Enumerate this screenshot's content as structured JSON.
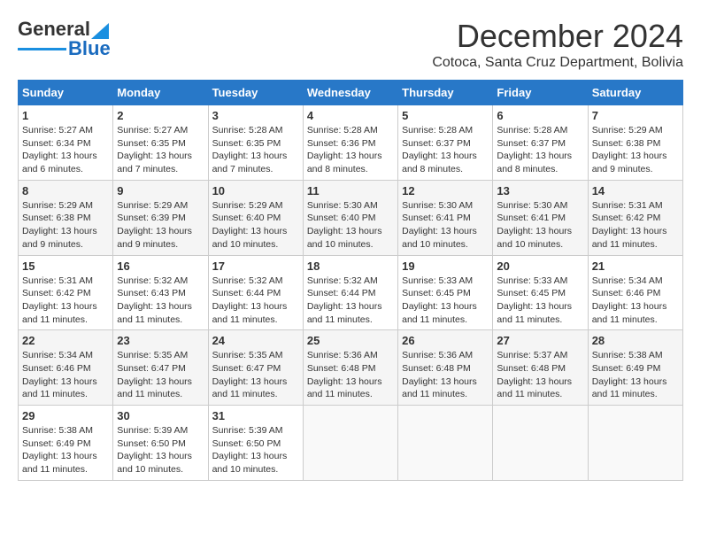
{
  "logo": {
    "line1": "General",
    "line2": "Blue"
  },
  "title": "December 2024",
  "subtitle": "Cotoca, Santa Cruz Department, Bolivia",
  "days_of_week": [
    "Sunday",
    "Monday",
    "Tuesday",
    "Wednesday",
    "Thursday",
    "Friday",
    "Saturday"
  ],
  "weeks": [
    [
      {
        "day": "1",
        "info": "Sunrise: 5:27 AM\nSunset: 6:34 PM\nDaylight: 13 hours and 6 minutes."
      },
      {
        "day": "2",
        "info": "Sunrise: 5:27 AM\nSunset: 6:35 PM\nDaylight: 13 hours and 7 minutes."
      },
      {
        "day": "3",
        "info": "Sunrise: 5:28 AM\nSunset: 6:35 PM\nDaylight: 13 hours and 7 minutes."
      },
      {
        "day": "4",
        "info": "Sunrise: 5:28 AM\nSunset: 6:36 PM\nDaylight: 13 hours and 8 minutes."
      },
      {
        "day": "5",
        "info": "Sunrise: 5:28 AM\nSunset: 6:37 PM\nDaylight: 13 hours and 8 minutes."
      },
      {
        "day": "6",
        "info": "Sunrise: 5:28 AM\nSunset: 6:37 PM\nDaylight: 13 hours and 8 minutes."
      },
      {
        "day": "7",
        "info": "Sunrise: 5:29 AM\nSunset: 6:38 PM\nDaylight: 13 hours and 9 minutes."
      }
    ],
    [
      {
        "day": "8",
        "info": "Sunrise: 5:29 AM\nSunset: 6:38 PM\nDaylight: 13 hours and 9 minutes."
      },
      {
        "day": "9",
        "info": "Sunrise: 5:29 AM\nSunset: 6:39 PM\nDaylight: 13 hours and 9 minutes."
      },
      {
        "day": "10",
        "info": "Sunrise: 5:29 AM\nSunset: 6:40 PM\nDaylight: 13 hours and 10 minutes."
      },
      {
        "day": "11",
        "info": "Sunrise: 5:30 AM\nSunset: 6:40 PM\nDaylight: 13 hours and 10 minutes."
      },
      {
        "day": "12",
        "info": "Sunrise: 5:30 AM\nSunset: 6:41 PM\nDaylight: 13 hours and 10 minutes."
      },
      {
        "day": "13",
        "info": "Sunrise: 5:30 AM\nSunset: 6:41 PM\nDaylight: 13 hours and 10 minutes."
      },
      {
        "day": "14",
        "info": "Sunrise: 5:31 AM\nSunset: 6:42 PM\nDaylight: 13 hours and 11 minutes."
      }
    ],
    [
      {
        "day": "15",
        "info": "Sunrise: 5:31 AM\nSunset: 6:42 PM\nDaylight: 13 hours and 11 minutes."
      },
      {
        "day": "16",
        "info": "Sunrise: 5:32 AM\nSunset: 6:43 PM\nDaylight: 13 hours and 11 minutes."
      },
      {
        "day": "17",
        "info": "Sunrise: 5:32 AM\nSunset: 6:44 PM\nDaylight: 13 hours and 11 minutes."
      },
      {
        "day": "18",
        "info": "Sunrise: 5:32 AM\nSunset: 6:44 PM\nDaylight: 13 hours and 11 minutes."
      },
      {
        "day": "19",
        "info": "Sunrise: 5:33 AM\nSunset: 6:45 PM\nDaylight: 13 hours and 11 minutes."
      },
      {
        "day": "20",
        "info": "Sunrise: 5:33 AM\nSunset: 6:45 PM\nDaylight: 13 hours and 11 minutes."
      },
      {
        "day": "21",
        "info": "Sunrise: 5:34 AM\nSunset: 6:46 PM\nDaylight: 13 hours and 11 minutes."
      }
    ],
    [
      {
        "day": "22",
        "info": "Sunrise: 5:34 AM\nSunset: 6:46 PM\nDaylight: 13 hours and 11 minutes."
      },
      {
        "day": "23",
        "info": "Sunrise: 5:35 AM\nSunset: 6:47 PM\nDaylight: 13 hours and 11 minutes."
      },
      {
        "day": "24",
        "info": "Sunrise: 5:35 AM\nSunset: 6:47 PM\nDaylight: 13 hours and 11 minutes."
      },
      {
        "day": "25",
        "info": "Sunrise: 5:36 AM\nSunset: 6:48 PM\nDaylight: 13 hours and 11 minutes."
      },
      {
        "day": "26",
        "info": "Sunrise: 5:36 AM\nSunset: 6:48 PM\nDaylight: 13 hours and 11 minutes."
      },
      {
        "day": "27",
        "info": "Sunrise: 5:37 AM\nSunset: 6:48 PM\nDaylight: 13 hours and 11 minutes."
      },
      {
        "day": "28",
        "info": "Sunrise: 5:38 AM\nSunset: 6:49 PM\nDaylight: 13 hours and 11 minutes."
      }
    ],
    [
      {
        "day": "29",
        "info": "Sunrise: 5:38 AM\nSunset: 6:49 PM\nDaylight: 13 hours and 11 minutes."
      },
      {
        "day": "30",
        "info": "Sunrise: 5:39 AM\nSunset: 6:50 PM\nDaylight: 13 hours and 10 minutes."
      },
      {
        "day": "31",
        "info": "Sunrise: 5:39 AM\nSunset: 6:50 PM\nDaylight: 13 hours and 10 minutes."
      },
      {
        "day": "",
        "info": ""
      },
      {
        "day": "",
        "info": ""
      },
      {
        "day": "",
        "info": ""
      },
      {
        "day": "",
        "info": ""
      }
    ]
  ]
}
